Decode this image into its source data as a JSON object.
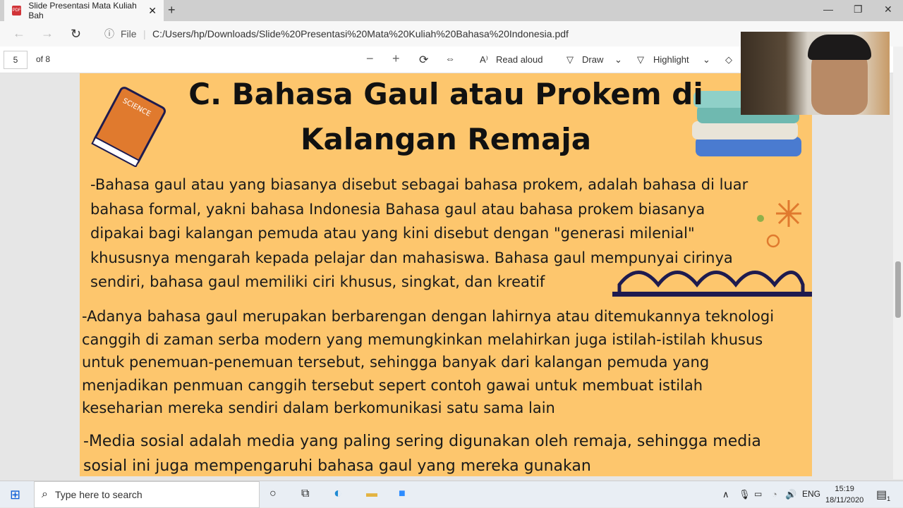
{
  "browser": {
    "tab_title": "Slide Presentasi Mata Kuliah Bah",
    "new_tab": "+",
    "file_label": "File",
    "url": "C:/Users/hp/Downloads/Slide%20Presentasi%20Mata%20Kuliah%20Bahasa%20Indonesia.pdf"
  },
  "pdf_toolbar": {
    "page": "5",
    "of": "of 8",
    "read_aloud": "Read aloud",
    "draw": "Draw",
    "highlight": "Highlight"
  },
  "slide": {
    "title_lines": [
      "C. Bahasa Gaul atau Prokem di",
      "Kalangan Remaja"
    ],
    "p1": [
      "-Bahasa gaul atau yang biasanya disebut sebagai bahasa prokem, adalah bahasa di luar",
      "bahasa formal, yakni bahasa Indonesia Bahasa gaul atau bahasa prokem biasanya",
      "dipakai bagi kalangan pemuda atau yang kini disebut dengan \"generasi milenial\"",
      "khususnya mengarah kepada pelajar dan mahasiswa. Bahasa gaul mempunyai cirinya",
      "sendiri, bahasa gaul memiliki ciri khusus, singkat, dan kreatif"
    ],
    "p2": [
      "-Adanya bahasa gaul merupakan berbarengan dengan lahirnya atau ditemukannya teknologi",
      "canggih di zaman serba modern yang memungkinkan melahirkan juga istilah-istilah khusus",
      "untuk penemuan-penemuan tersebut, sehingga banyak dari kalangan pemuda yang",
      "menjadikan penmuan canggih tersebut sepert contoh gawai untuk membuat istilah",
      "keseharian mereka sendiri dalam berkomunikasi satu sama lain"
    ],
    "p3": [
      "-Media sosial adalah media yang paling sering digunakan oleh remaja, sehingga media",
      "sosial ini juga mempengaruhi bahasa gaul yang mereka gunakan"
    ],
    "book_label": "SCIENCE"
  },
  "taskbar": {
    "search_placeholder": "Type here to search",
    "lang": "ENG",
    "time": "15:19",
    "date": "18/11/2020",
    "notifications": "1"
  },
  "colors": {
    "slide_bg": "#fdc66d",
    "accent": "#1e1b4f"
  }
}
